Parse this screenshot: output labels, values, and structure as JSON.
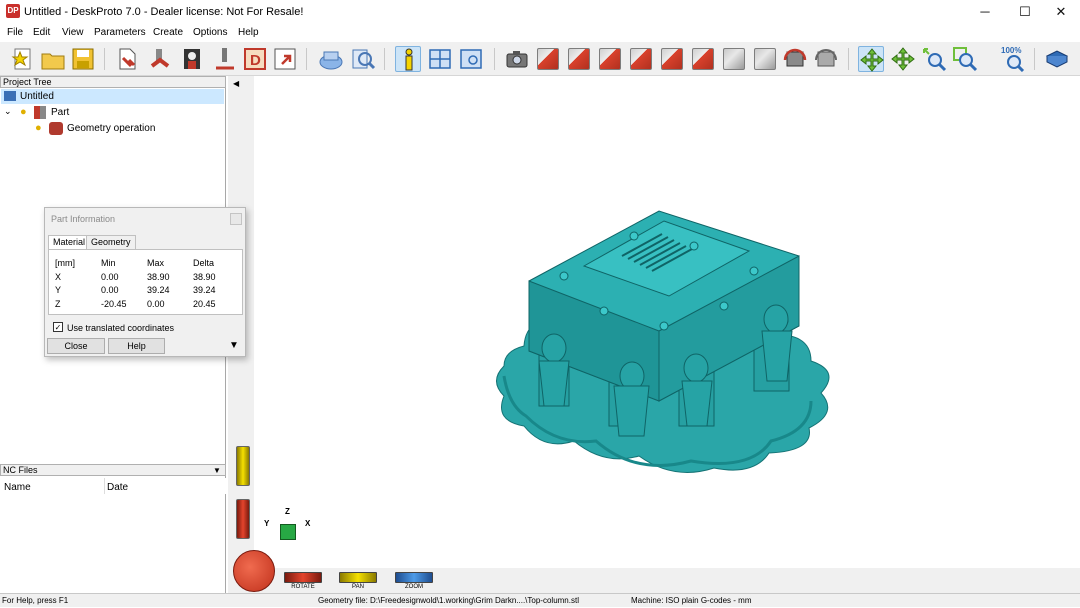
{
  "window": {
    "title": "Untitled - DeskProto 7.0 - Dealer license: Not For Resale!",
    "icon": "DP",
    "minimize": "─",
    "maximize": "☐",
    "close": "✕"
  },
  "menu": [
    "File",
    "Edit",
    "View",
    "Parameters",
    "Create",
    "Options",
    "Help"
  ],
  "project_tree": {
    "header": "Project Tree",
    "root": "Untitled",
    "part": "Part",
    "operation": "Geometry operation"
  },
  "nc_files": {
    "header": "NC Files",
    "col_name": "Name",
    "col_date": "Date"
  },
  "dialog": {
    "title": "Part Information",
    "tabs": [
      "Material",
      "Geometry"
    ],
    "table": {
      "headers": [
        "[mm]",
        "Min",
        "Max",
        "Delta"
      ],
      "rows": [
        [
          "X",
          "0.00",
          "38.90",
          "38.90"
        ],
        [
          "Y",
          "0.00",
          "39.24",
          "39.24"
        ],
        [
          "Z",
          "-20.45",
          "0.00",
          "20.45"
        ]
      ]
    },
    "checkbox_label": "Use translated coordinates",
    "checkbox_checked": true,
    "close_label": "Close",
    "help_label": "Help"
  },
  "axis": {
    "x": "X",
    "y": "Y",
    "z": "Z"
  },
  "view_buttons": {
    "rotate": "ROTATE",
    "pan": "PAN",
    "zoom": "ZOOM"
  },
  "toolbar": {
    "zoom100": "100%"
  },
  "status": {
    "help": "For Help, press F1",
    "geometry": "Geometry file: D:\\Freedesignwold\\1.working\\Grim Darkn....\\Top-column.stl",
    "machine": "Machine: ISO plain G-codes - mm"
  },
  "colors": {
    "model": "#2aa6a8",
    "model_dark": "#167e80",
    "selection": "#cce8ff"
  }
}
